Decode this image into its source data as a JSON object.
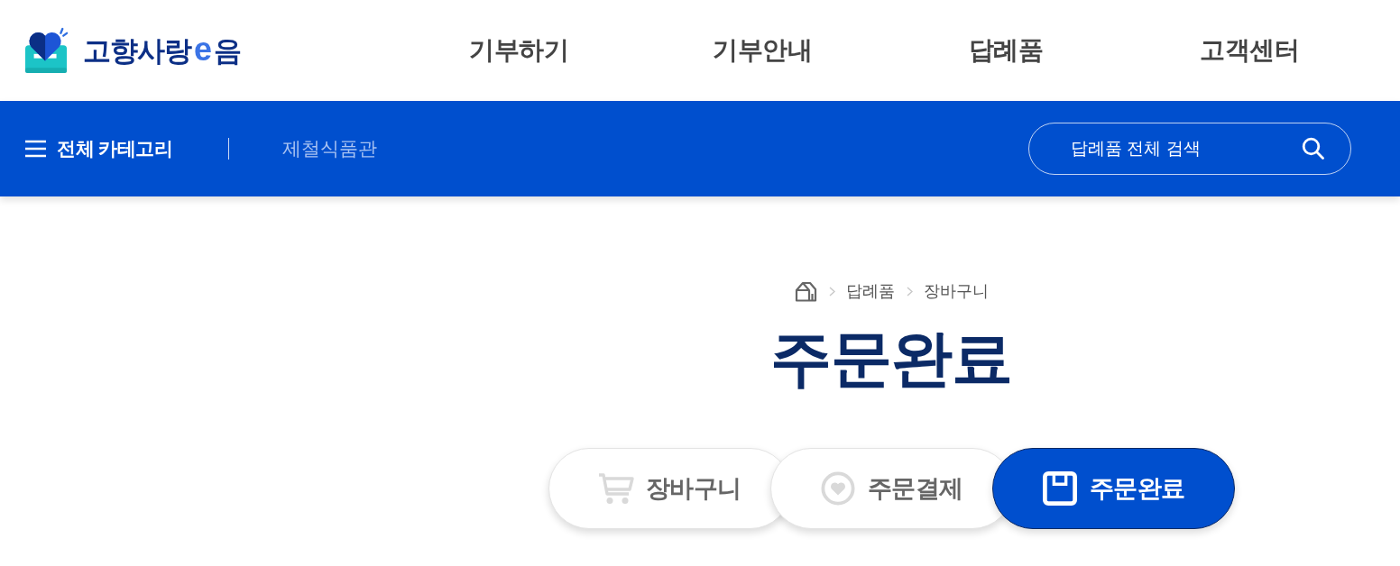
{
  "header": {
    "logo": {
      "name": "고향사랑",
      "mark": "e",
      "suffix": "음"
    },
    "nav": [
      "기부하기",
      "기부안내",
      "답례품",
      "고객센터"
    ]
  },
  "category_bar": {
    "menu_label": "전체 카테고리",
    "links": [
      "제철식품관"
    ],
    "search": {
      "placeholder": "답례품 전체 검색"
    }
  },
  "breadcrumb": [
    "답례품",
    "장바구니"
  ],
  "title": "주문완료",
  "steps": [
    {
      "label": "장바구니",
      "selected": false
    },
    {
      "label": "주문결제",
      "selected": false
    },
    {
      "label": "주문완료",
      "selected": true
    }
  ]
}
